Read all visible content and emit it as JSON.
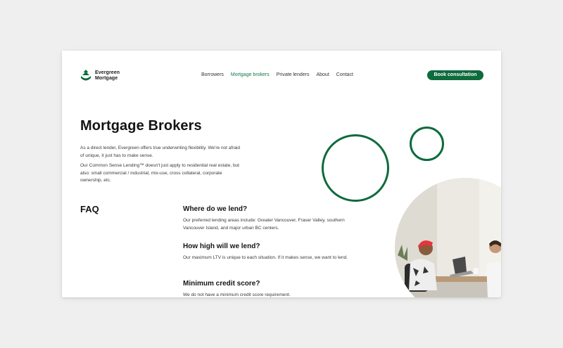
{
  "brand": {
    "line1": "Evergreen",
    "line2": "Mortgage",
    "accent": "#0d6b3c"
  },
  "nav": {
    "items": [
      {
        "label": "Borrowers",
        "active": false
      },
      {
        "label": "Mortgage brokers",
        "active": true
      },
      {
        "label": "Private lenders",
        "active": false
      },
      {
        "label": "About",
        "active": false
      },
      {
        "label": "Contact",
        "active": false
      }
    ],
    "cta_label": "Book consultation"
  },
  "hero": {
    "title": "Mortgage Brokers",
    "paragraphs": [
      "As a direct lender, Evergreen offers true underwriting flexibility. We're not afraid of unique, it just has to make sense.",
      "Our Common Sense Lending™ doesn't just apply to residential real estate, but also: small commercial / industrial, mix-use, cross collateral, corporate ownership, etc."
    ]
  },
  "faq": {
    "heading": "FAQ",
    "items": [
      {
        "question": "Where do we lend?",
        "answer": "Our preferred lending areas include: Greater Vancouver, Fraser Valley, southern Vancouver Island, and major urban BC centers."
      },
      {
        "question": "How high will we lend?",
        "answer": "Our maximum LTV is unique to each situation. If it makes sense, we want to lend."
      },
      {
        "question": "Minimum credit score?",
        "answer": "We do not have a minimum credit score requirement."
      }
    ]
  }
}
